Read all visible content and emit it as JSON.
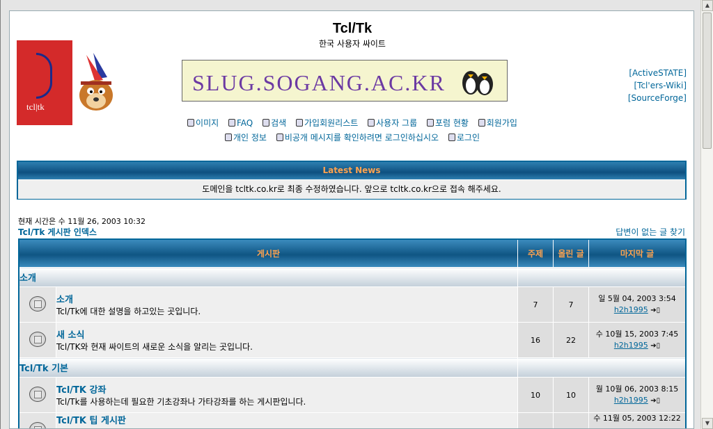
{
  "site": {
    "title": "Tcl/Tk",
    "subtitle": "한국 사용자 싸이트",
    "logo_text": "tcl|tk"
  },
  "banner": {
    "text": "SLUG.SOGANG.AC.KR"
  },
  "sidelinks": [
    "[ActiveSTATE]",
    "[Tcl'ers-Wiki]",
    "[SourceForge]"
  ],
  "nav_row1": [
    "이미지",
    "FAQ",
    "검색",
    "가입회원리스트",
    "사용자 그룹",
    "포럼 현황",
    "회원가입"
  ],
  "nav_row2": [
    "개인 정보",
    "비공개 메시지를 확인하려면 로그인하십시오",
    "로그인"
  ],
  "news": {
    "heading": "Latest News",
    "body": "도메인을 tcltk.co.kr로 최종 수정하였습니다. 앞으로 tcltk.co.kr으로 접속 해주세요."
  },
  "current_time": "현재 시간은 수 11월 26, 2003 10:32",
  "index_link": "Tcl/Tk 게시판 인덱스",
  "unanswered_link": "답변이 없는 글 찾기",
  "table": {
    "headers": {
      "forum": "게시판",
      "topics": "주제",
      "posts": "올린 글",
      "last": "마지막 글"
    },
    "categories": [
      {
        "name": "소개",
        "forums": [
          {
            "name": "소개",
            "desc": "Tcl/Tk에 대한 설명을 하고있는 곳입니다.",
            "topics": "7",
            "posts": "7",
            "last_date": "일 5월 04, 2003 3:54",
            "last_user": "h2h1995"
          },
          {
            "name": "새 소식",
            "desc": "Tcl/TK와 현재 싸이트의 새로운 소식을 알리는 곳입니다.",
            "topics": "16",
            "posts": "22",
            "last_date": "수 10월 15, 2003 7:45",
            "last_user": "h2h1995"
          }
        ]
      },
      {
        "name": "Tcl/Tk 기본",
        "forums": [
          {
            "name": "Tcl/TK 강좌",
            "desc": "Tcl/Tk를 사용하는데 필요한 기초강좌나 가타강좌를 하는 게시판입니다.",
            "topics": "10",
            "posts": "10",
            "last_date": "월 10월 06, 2003 8:15",
            "last_user": "h2h1995"
          },
          {
            "name": "Tcl/TK 팁 게시판",
            "desc": "",
            "topics": "",
            "posts": "",
            "last_date": "수 11월 05, 2003 12:22",
            "last_user": ""
          }
        ]
      }
    ]
  }
}
